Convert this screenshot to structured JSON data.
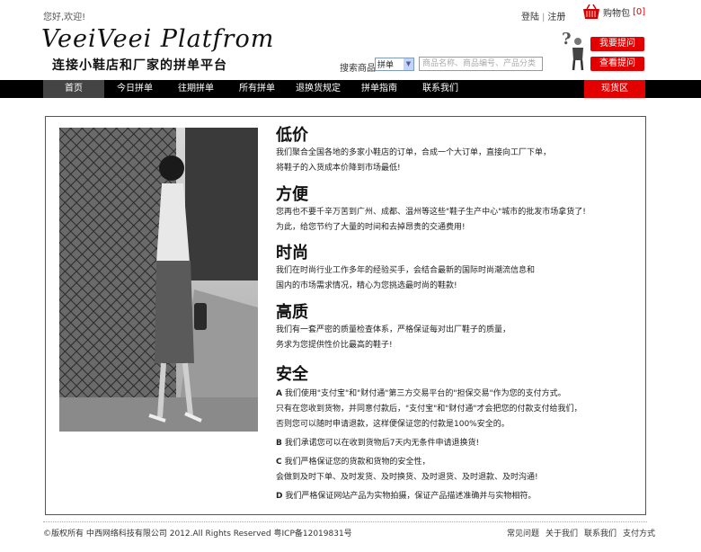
{
  "top": {
    "greeting": "您好,欢迎!",
    "login": "登陆",
    "register": "注册",
    "cart_label": "购物包",
    "cart_count": "[0]"
  },
  "logo": {
    "en": "VeeiVeei Platfrom",
    "cn": "连接小鞋店和厂家的拼单平台"
  },
  "search": {
    "label": "搜索商品",
    "select_value": "拼单",
    "placeholder": "商品名称、商品编号、产品分类"
  },
  "buttons": {
    "ask": "我要提问",
    "view": "查看提问"
  },
  "nav": [
    "首页",
    "今日拼单",
    "往期拼单",
    "所有拼单",
    "退换货规定",
    "拼单指南",
    "联系我们",
    "现货区"
  ],
  "sections": [
    {
      "title": "低价",
      "lines": [
        "我们聚合全国各地的多家小鞋店的订单，合成一个大订单，直接向工厂下单，",
        "将鞋子的入货成本价降到市场最低!"
      ]
    },
    {
      "title": "方便",
      "lines": [
        "您再也不要千辛万苦到广州、成都、温州等这些\"鞋子生产中心\"城市的批发市场拿货了!",
        "为此，给您节约了大量的时间和去掉昂贵的交通费用!"
      ]
    },
    {
      "title": "时尚",
      "lines": [
        "我们在时尚行业工作多年的经验买手，会结合最新的国际时尚潮流信息和",
        "国内的市场需求情况，精心为您挑选最时尚的鞋款!"
      ]
    },
    {
      "title": "高质",
      "lines": [
        "我们有一套严密的质量检查体系，严格保证每对出厂鞋子的质量，",
        "务求为您提供性价比最高的鞋子!"
      ]
    },
    {
      "title": "安全",
      "items": [
        {
          "letter": "A",
          "lines": [
            "我们使用\"支付宝\"和\"财付通\"第三方交易平台的\"担保交易\"作为您的支付方式。",
            "只有在您收到货物，并同意付款后，\"支付宝\"和\"财付通\"才会把您的付款支付给我们，",
            "否则您可以随时申请退款，这样便保证您的付款是100%安全的。"
          ]
        },
        {
          "letter": "B",
          "lines": [
            "我们承诺您可以在收到货物后7天内无条件申请退换货!"
          ]
        },
        {
          "letter": "C",
          "lines": [
            "我们严格保证您的货款和货物的安全性，",
            "会做到及时下单、及时发货、及时换货、及时退货、及时退款、及时沟通!"
          ]
        },
        {
          "letter": "D",
          "lines": [
            "我们严格保证网站产品为实物拍摄，保证产品描述准确并与实物相符。"
          ]
        }
      ]
    }
  ],
  "footer": {
    "copyright": "©版权所有  中西网络科技有限公司  2012.All Rights Reserved 粤ICP备12019831号",
    "links": [
      "常见问题",
      "关于我们",
      "联系我们",
      "支付方式"
    ]
  },
  "colors": {
    "accent": "#e30000",
    "nav_bg": "#000000"
  }
}
